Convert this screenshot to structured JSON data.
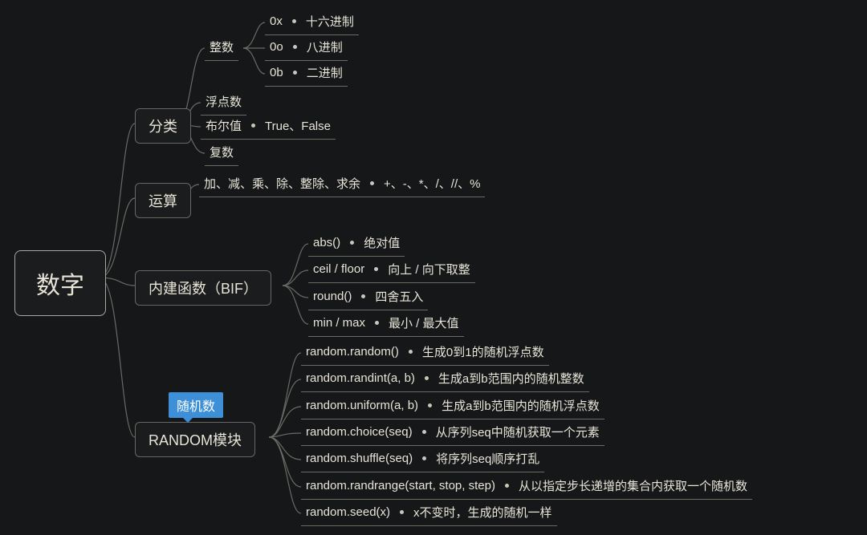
{
  "root": "数字",
  "branches": {
    "category": {
      "label": "分类",
      "children": {
        "int": {
          "label": "整数",
          "leaves": [
            {
              "term": "0x",
              "desc": "十六进制"
            },
            {
              "term": "0o",
              "desc": "八进制"
            },
            {
              "term": "0b",
              "desc": "二进制"
            }
          ]
        },
        "float": {
          "label": "浮点数"
        },
        "bool": {
          "label": "布尔值",
          "desc": "True、False"
        },
        "complex": {
          "label": "复数"
        }
      }
    },
    "ops": {
      "label": "运算",
      "leaf": {
        "term": "加、减、乘、除、整除、求余",
        "desc": "+、-、*、/、//、%"
      }
    },
    "bif": {
      "label": "内建函数（BIF）",
      "leaves": [
        {
          "term": "abs()",
          "desc": "绝对值"
        },
        {
          "term": "ceil / floor",
          "desc": "向上 / 向下取整"
        },
        {
          "term": "round()",
          "desc": "四舍五入"
        },
        {
          "term": "min / max",
          "desc": "最小 / 最大值"
        }
      ]
    },
    "random": {
      "label": "RANDOM模块",
      "tag": "随机数",
      "leaves": [
        {
          "term": "random.random()",
          "desc": "生成0到1的随机浮点数"
        },
        {
          "term": "random.randint(a, b)",
          "desc": "生成a到b范围内的随机整数"
        },
        {
          "term": "random.uniform(a, b)",
          "desc": "生成a到b范围内的随机浮点数"
        },
        {
          "term": "random.choice(seq)",
          "desc": "从序列seq中随机获取一个元素"
        },
        {
          "term": "random.shuffle(seq)",
          "desc": "将序列seq顺序打乱"
        },
        {
          "term": "random.randrange(start, stop, step)",
          "desc": "从以指定步长递增的集合内获取一个随机数"
        },
        {
          "term": "random.seed(x)",
          "desc": "x不变时，生成的随机一样"
        }
      ]
    }
  }
}
